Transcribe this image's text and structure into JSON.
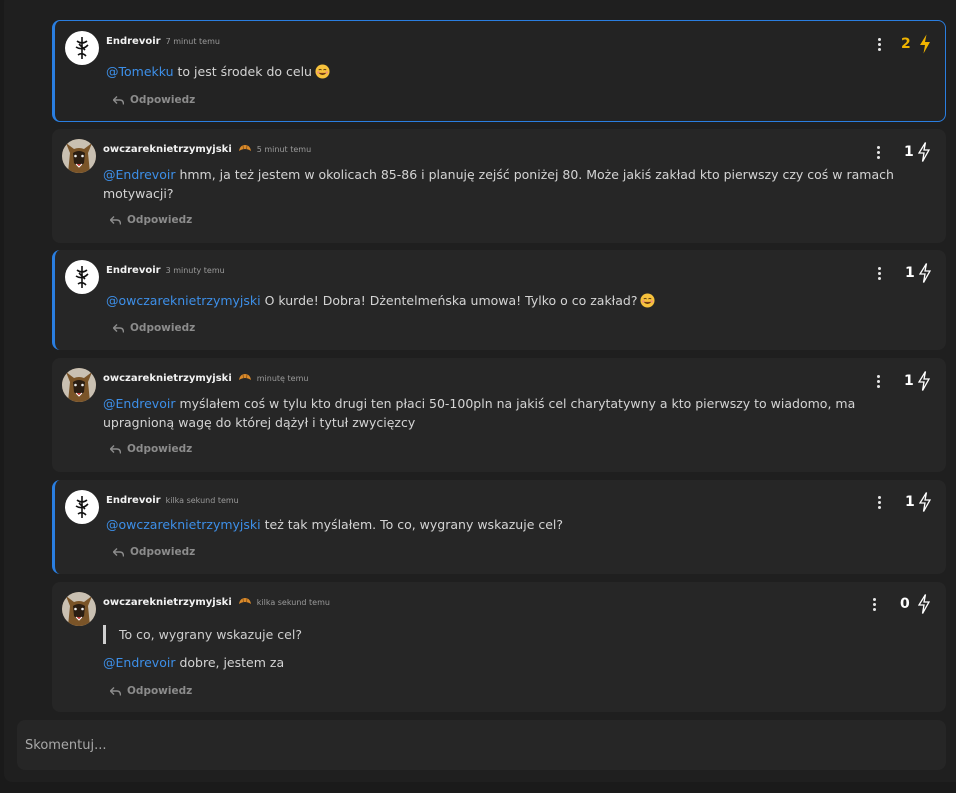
{
  "comments": [
    {
      "author": "Endrevoir",
      "time": "7 minut temu",
      "mention": "@Tomekku",
      "text": " to jest środek do celu",
      "emoji": "smiling-face-emoji",
      "reply_label": "Odpowiedz",
      "votes": "2",
      "voted": true
    },
    {
      "author": "owczareknietrzymyjski",
      "badge": "croissant-icon",
      "time": "5 minut temu",
      "mention": "@Endrevoir",
      "text": " hmm, ja też jestem w okolicach 85-86 i planuję zejść poniżej 80. Może jakiś zakład kto pierwszy czy coś w ramach motywacji?",
      "reply_label": "Odpowiedz",
      "votes": "1"
    },
    {
      "author": "Endrevoir",
      "time": "3 minuty temu",
      "mention": "@owczareknietrzymyjski",
      "text": " O kurde! Dobra! Dżentelmeńska umowa! Tylko o co zakład?",
      "emoji": "smiling-face-emoji",
      "reply_label": "Odpowiedz",
      "votes": "1"
    },
    {
      "author": "owczareknietrzymyjski",
      "badge": "croissant-icon",
      "time": "minutę temu",
      "mention": "@Endrevoir",
      "text": " myślałem coś w tylu kto drugi ten płaci 50-100pln na jakiś cel charytatywny a kto pierwszy to wiadomo, ma upragnioną wagę do której dążył i tytuł zwycięzcy",
      "reply_label": "Odpowiedz",
      "votes": "1"
    },
    {
      "author": "Endrevoir",
      "time": "kilka sekund temu",
      "mention": "@owczareknietrzymyjski",
      "text": " też tak myślałem. To co, wygrany wskazuje cel?",
      "reply_label": "Odpowiedz",
      "votes": "1"
    },
    {
      "author": "owczareknietrzymyjski",
      "badge": "croissant-icon",
      "time": "kilka sekund temu",
      "quote": "To co, wygrany wskazuje cel?",
      "mention": "@Endrevoir",
      "text": " dobre, jestem za",
      "reply_label": "Odpowiedz",
      "votes": "0"
    }
  ],
  "comment_input": {
    "placeholder": "Skomentuj..."
  },
  "colors": {
    "accent": "#2a7ee0",
    "mention": "#3d8fe8",
    "vote_active": "#f0b400"
  }
}
